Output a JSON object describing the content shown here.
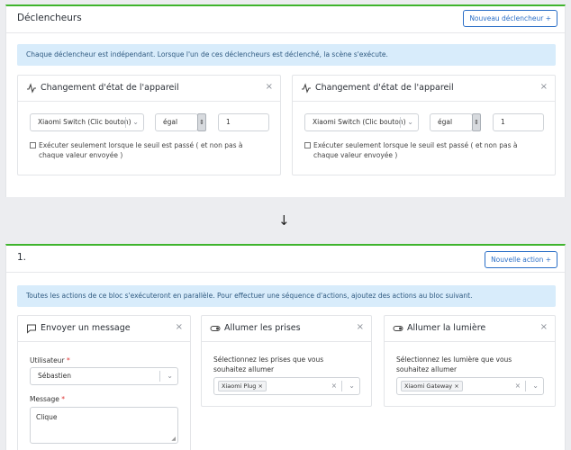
{
  "triggers": {
    "title": "Déclencheurs",
    "new_button": "Nouveau déclencheur +",
    "info": "Chaque déclencheur est indépendant. Lorsque l'un de ces déclencheurs est déclenché, la scène s'exécute.",
    "items": [
      {
        "title": "Changement d'état de l'appareil",
        "device": "Xiaomi Switch (Clic bouton)",
        "operator": "égal",
        "value": "1",
        "checkbox_label": "Exécuter seulement lorsque le seuil est passé ( et non pas à chaque valeur envoyée )",
        "close": "×"
      },
      {
        "title": "Changement d'état de l'appareil",
        "device": "Xiaomi Switch (Clic bouton)",
        "operator": "égal",
        "value": "1",
        "checkbox_label": "Exécuter seulement lorsque le seuil est passé ( et non pas à chaque valeur envoyée )",
        "close": "×"
      }
    ]
  },
  "arrow": "↓",
  "actions": {
    "title": "1.",
    "new_button": "Nouvelle action +",
    "info": "Toutes les actions de ce bloc s'exécuteront en parallèle. Pour effectuer une séquence d'actions, ajoutez des actions au bloc suivant.",
    "message": {
      "title": "Envoyer un message",
      "user_label": "Utilisateur",
      "user_value": "Sébastien",
      "message_label": "Message",
      "message_value": "Clique",
      "required": "*",
      "close": "×"
    },
    "plugs": {
      "title": "Allumer les prises",
      "select_label": "Sélectionnez les prises que vous souhaitez allumer",
      "tag": "Xiaomi Plug",
      "close": "×"
    },
    "lights": {
      "title": "Allumer la lumière",
      "select_label": "Sélectionnez les lumière que vous souhaitez allumer",
      "tag": "Xiaomi Gateway",
      "close": "×"
    }
  },
  "colors": {
    "accent_green": "#3fb42d",
    "primary_blue": "#2b6fc7",
    "info_bg": "#d8ecfb"
  }
}
